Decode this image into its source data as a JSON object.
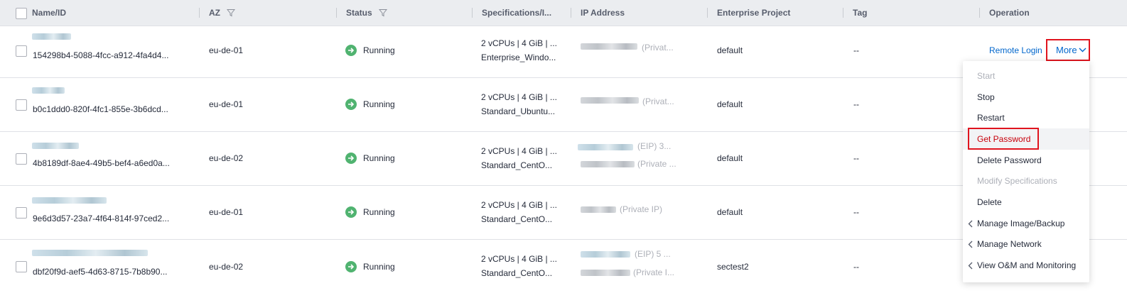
{
  "columns": {
    "name": "Name/ID",
    "az": "AZ",
    "status": "Status",
    "spec": "Specifications/I...",
    "ip": "IP Address",
    "project": "Enterprise Project",
    "tag": "Tag",
    "operation": "Operation"
  },
  "rows": [
    {
      "id": "154298b4-5088-4fcc-a912-4fa4d4...",
      "az": "eu-de-01",
      "status": "Running",
      "spec1": "2 vCPUs | 4 GiB | ...",
      "spec2": "Enterprise_Windo...",
      "ip1": "(Privat...",
      "ip2": "",
      "project": "default",
      "tag": "--"
    },
    {
      "id": "b0c1ddd0-820f-4fc1-855e-3b6dcd...",
      "az": "eu-de-01",
      "status": "Running",
      "spec1": "2 vCPUs | 4 GiB | ...",
      "spec2": "Standard_Ubuntu...",
      "ip1": "(Privat...",
      "ip2": "",
      "project": "default",
      "tag": "--"
    },
    {
      "id": "4b8189df-8ae4-49b5-bef4-a6ed0a...",
      "az": "eu-de-02",
      "status": "Running",
      "spec1": "2 vCPUs | 4 GiB | ...",
      "spec2": "Standard_CentO...",
      "ip1": "(EIP) 3...",
      "ip2": "(Private ...",
      "project": "default",
      "tag": "--"
    },
    {
      "id": "9e6d3d57-23a7-4f64-814f-97ced2...",
      "az": "eu-de-01",
      "status": "Running",
      "spec1": "2 vCPUs | 4 GiB | ...",
      "spec2": "Standard_CentO...",
      "ip1": "(Private IP)",
      "ip2": "",
      "project": "default",
      "tag": "--"
    },
    {
      "id": "dbf20f9d-aef5-4d63-8715-7b8b90...",
      "az": "eu-de-02",
      "status": "Running",
      "spec1": "2 vCPUs | 4 GiB | ...",
      "spec2": "Standard_CentO...",
      "ip1": "(EIP) 5 ...",
      "ip2": "(Private I...",
      "project": "sectest2",
      "tag": "--"
    }
  ],
  "operation": {
    "remote_login": "Remote Login",
    "more": "More"
  },
  "menu": [
    {
      "label": "Start",
      "disabled": true
    },
    {
      "label": "Stop"
    },
    {
      "label": "Restart"
    },
    {
      "label": "Get Password",
      "highlighted": true
    },
    {
      "label": "Delete Password"
    },
    {
      "label": "Modify Specifications",
      "disabled": true
    },
    {
      "label": "Delete"
    },
    {
      "label": "Manage Image/Backup",
      "submenu": true
    },
    {
      "label": "Manage Network",
      "submenu": true
    },
    {
      "label": "View O&M and Monitoring",
      "submenu": true
    }
  ],
  "colors": {
    "link": "#0066cc",
    "running": "#50b370",
    "highlight_border": "#e0141e",
    "highlight_text": "#c7000b"
  }
}
